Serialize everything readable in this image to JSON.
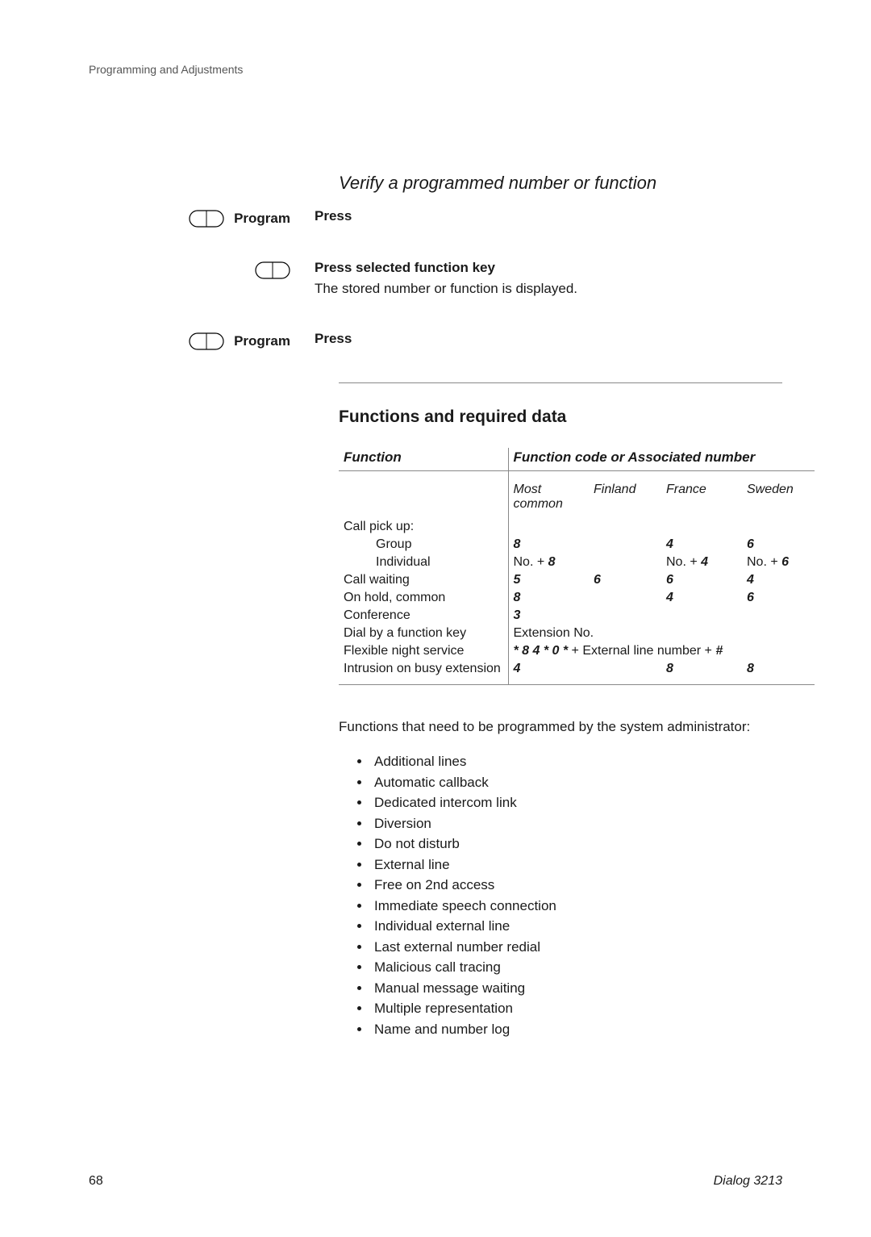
{
  "header": "Programming and Adjustments",
  "section_verify": {
    "title": "Verify a programmed number or function",
    "steps": [
      {
        "key_label": "Program",
        "has_key_label": true,
        "line1": "Press",
        "line2": ""
      },
      {
        "key_label": "",
        "has_key_label": false,
        "line1": "Press selected function key",
        "line2": "The stored number or function is displayed."
      },
      {
        "key_label": "Program",
        "has_key_label": true,
        "line1": "Press",
        "line2": ""
      }
    ]
  },
  "section_functions": {
    "title": "Functions and required data",
    "table": {
      "head_function": "Function",
      "head_code": "Function code or Associated number",
      "subcols": [
        "Most common",
        "Finland",
        "France",
        "Sweden"
      ],
      "rows": [
        {
          "label": "Call pick up:",
          "indent": false,
          "cells": [
            "",
            "",
            "",
            ""
          ]
        },
        {
          "label": "Group",
          "indent": true,
          "cells": [
            "8",
            "",
            "4",
            "6"
          ]
        },
        {
          "label": "Individual",
          "indent": true,
          "cells_mixed": [
            {
              "pre": "No. + ",
              "bold": "8"
            },
            {
              "pre": "",
              "bold": ""
            },
            {
              "pre": "No. + ",
              "bold": "4"
            },
            {
              "pre": "No. + ",
              "bold": "6"
            }
          ]
        },
        {
          "label": "Call waiting",
          "indent": false,
          "cells": [
            "5",
            "6",
            "6",
            "4"
          ]
        },
        {
          "label": "On hold, common",
          "indent": false,
          "cells": [
            "8",
            "",
            "4",
            "6"
          ]
        },
        {
          "label": "Conference",
          "indent": false,
          "cells": [
            "3",
            "",
            "",
            ""
          ]
        },
        {
          "label": "Dial by a function key",
          "indent": false,
          "full": "Extension No."
        },
        {
          "label": "Flexible night service",
          "indent": false,
          "full_code": {
            "code": "* 8 4 * 0 *",
            "suffix": " + External line number + ",
            "hash": "#"
          }
        },
        {
          "label": "Intrusion on busy extension",
          "indent": false,
          "cells": [
            "4",
            "",
            "8",
            "8"
          ]
        }
      ]
    },
    "paragraph": "Functions that need to be programmed by the system administrator:",
    "bullets": [
      "Additional lines",
      "Automatic callback",
      "Dedicated intercom link",
      "Diversion",
      "Do not disturb",
      "External line",
      "Free on 2nd access",
      "Immediate speech connection",
      "Individual external line",
      "Last external number redial",
      "Malicious call tracing",
      "Manual message waiting",
      "Multiple representation",
      "Name and number log"
    ]
  },
  "footer": {
    "page": "68",
    "doc": "Dialog 3213"
  }
}
